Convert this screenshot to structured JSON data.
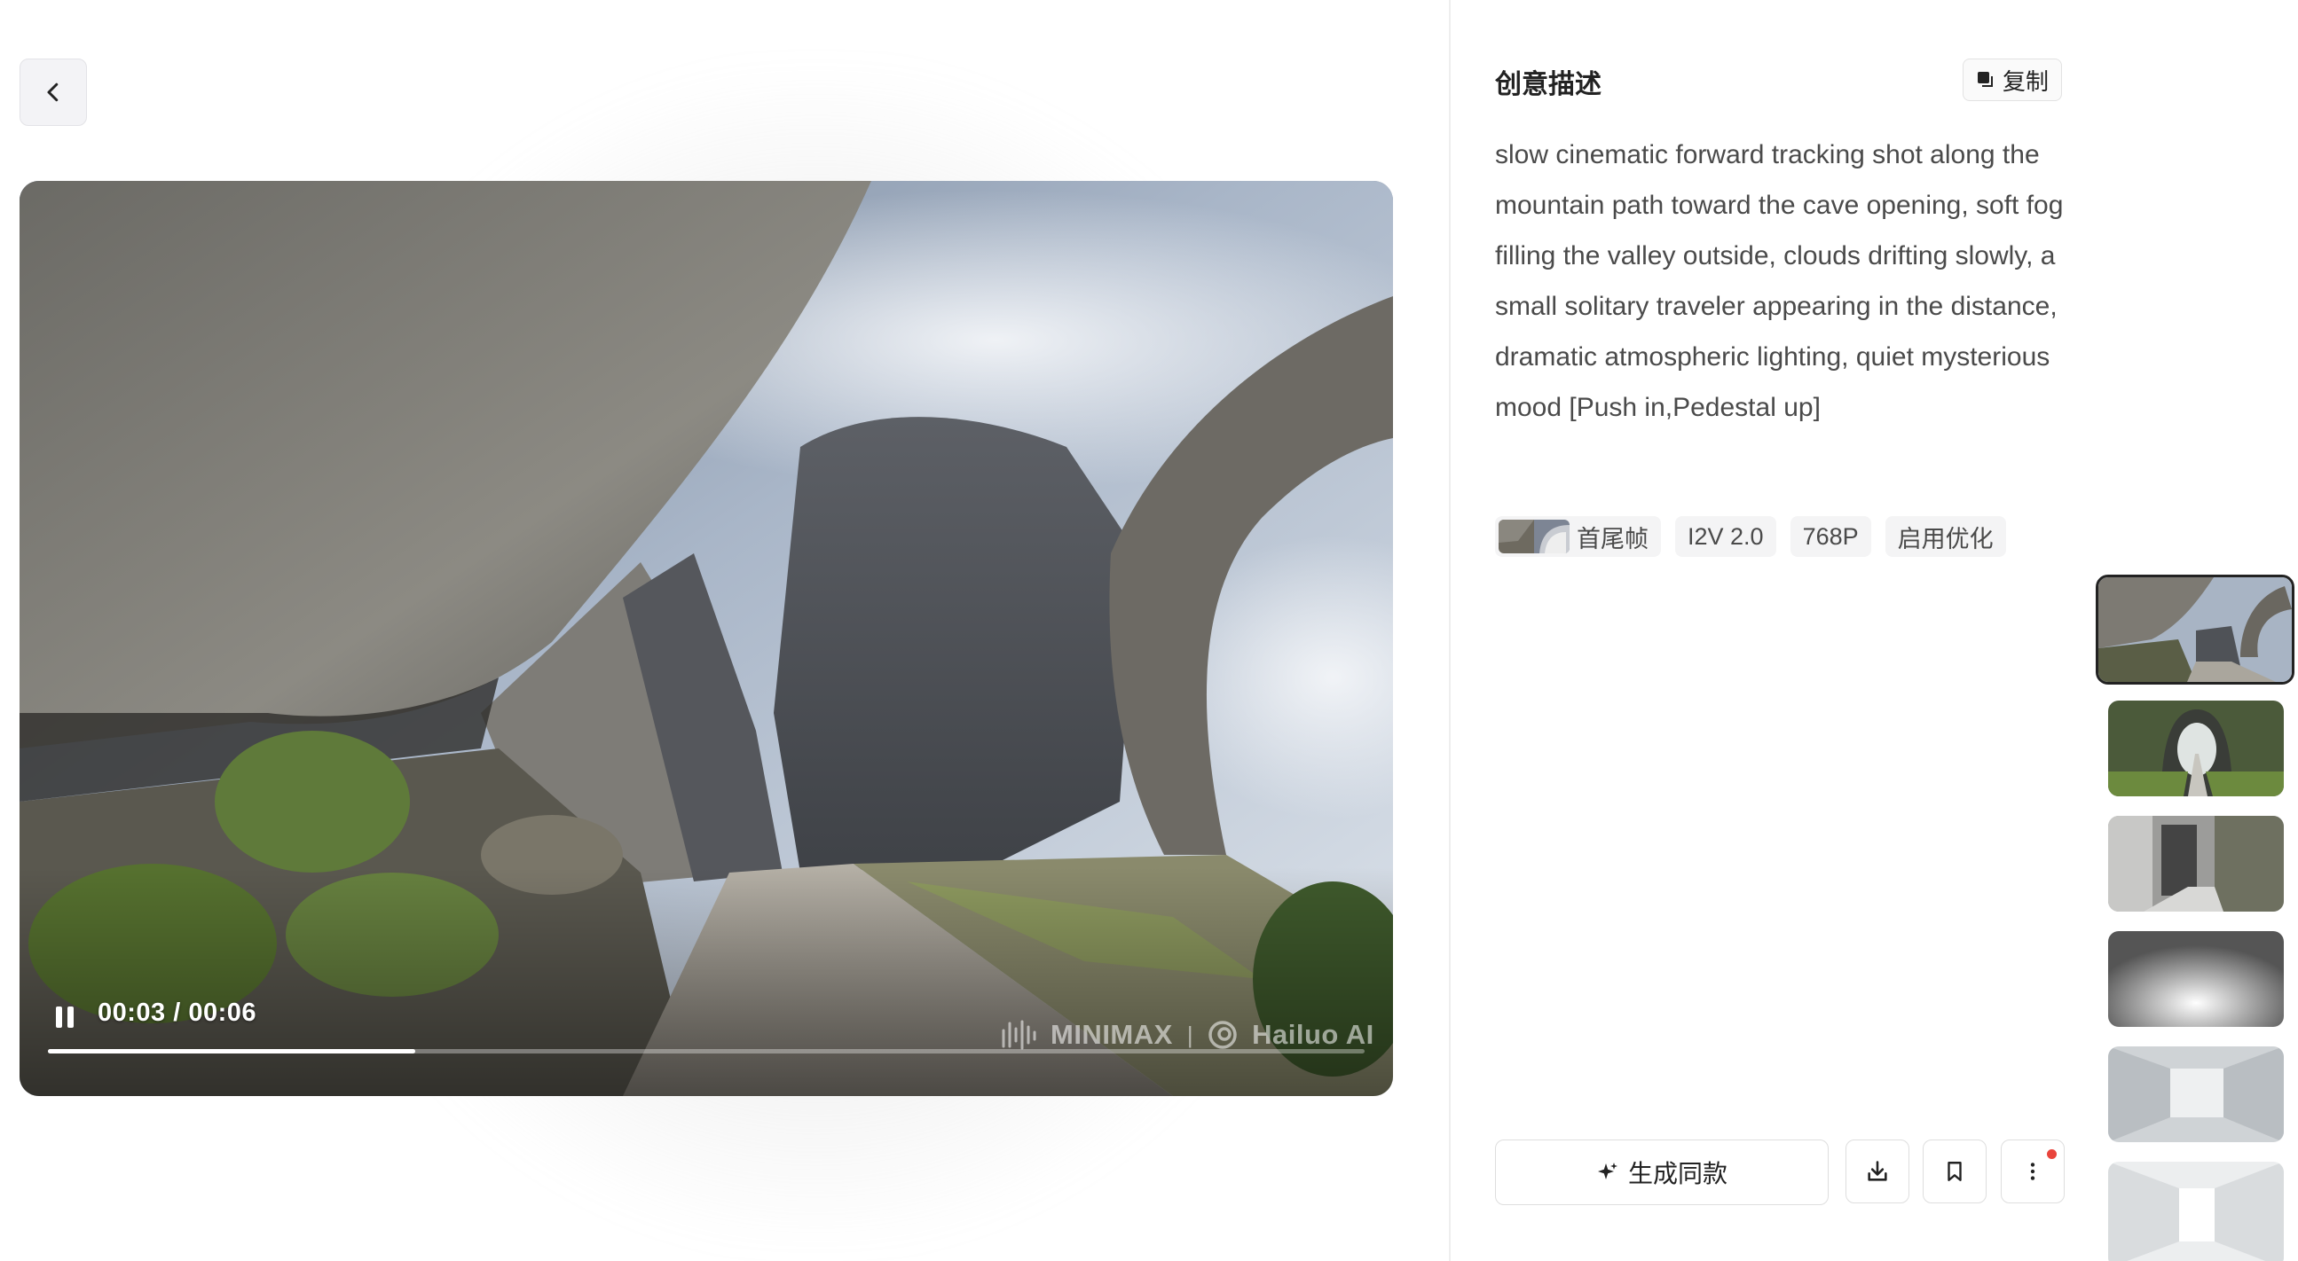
{
  "video": {
    "time": "00:03 / 00:06",
    "progress_fraction": 0.279,
    "watermark_left": "MINIMAX",
    "watermark_sep": "|",
    "watermark_right": "Hailuo AI"
  },
  "panel": {
    "title": "创意描述",
    "copy_label": "复制",
    "prompt": "slow cinematic forward tracking shot along the mountain path toward the cave opening, soft fog filling the valley outside, clouds drifting slowly, a small solitary traveler appearing in the distance, dramatic atmospheric lighting, quiet mysterious mood [Push in,Pedestal up]",
    "tags": [
      "首尾帧",
      "I2V 2.0",
      "768P",
      "启用优化"
    ]
  },
  "actions": {
    "generate_label": "生成同款"
  },
  "icons": {
    "back": "chevron-left-icon",
    "copy": "copy-icon",
    "pause": "pause-icon",
    "sparkle": "sparkle-icon",
    "download": "download-icon",
    "bookmark": "bookmark-icon",
    "more": "more-vertical-icon"
  },
  "colors": {
    "notification_dot": "#e9443c",
    "top_accent": "#f6d2dc"
  }
}
